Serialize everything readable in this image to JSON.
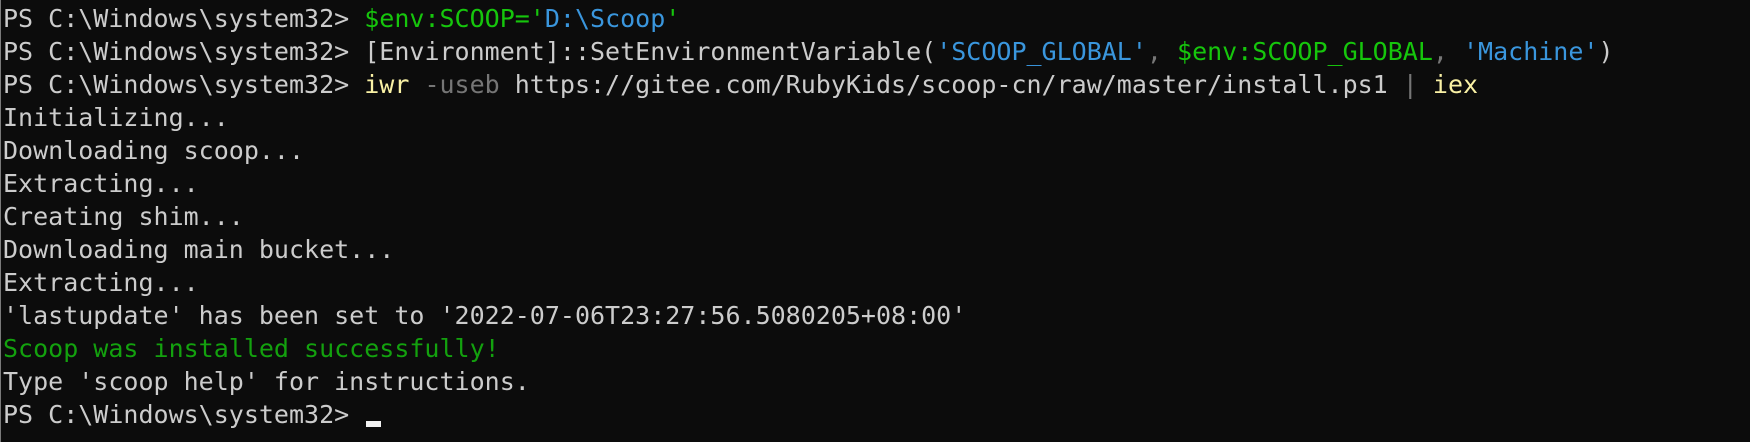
{
  "terminal": {
    "prompt": "PS C:\\Windows\\system32> ",
    "lines": [
      {
        "type": "command",
        "segments": [
          {
            "text": "$env:SCOOP='",
            "role": "var"
          },
          {
            "text": "D:\\Scoop",
            "role": "string"
          },
          {
            "text": "'",
            "role": "var"
          }
        ]
      },
      {
        "type": "command",
        "segments": [
          {
            "text": "[Environment]::SetEnvironmentVariable(",
            "role": "default"
          },
          {
            "text": "'SCOOP_GLOBAL'",
            "role": "string"
          },
          {
            "text": ", ",
            "role": "param"
          },
          {
            "text": "$env:SCOOP_GLOBAL",
            "role": "var"
          },
          {
            "text": ", ",
            "role": "param"
          },
          {
            "text": "'Machine'",
            "role": "string"
          },
          {
            "text": ")",
            "role": "default"
          }
        ]
      },
      {
        "type": "command",
        "segments": [
          {
            "text": "iwr",
            "role": "cmd"
          },
          {
            "text": " -useb",
            "role": "param"
          },
          {
            "text": " https://gitee.com/RubyKids/scoop-cn/raw/master/install.ps1",
            "role": "default"
          },
          {
            "text": " | ",
            "role": "param"
          },
          {
            "text": "iex",
            "role": "cmd"
          }
        ]
      },
      {
        "type": "output",
        "text": "Initializing...",
        "role": "default"
      },
      {
        "type": "output",
        "text": "Downloading scoop...",
        "role": "default"
      },
      {
        "type": "output",
        "text": "Extracting...",
        "role": "default"
      },
      {
        "type": "output",
        "text": "Creating shim...",
        "role": "default"
      },
      {
        "type": "output",
        "text": "Downloading main bucket...",
        "role": "default"
      },
      {
        "type": "output",
        "text": "Extracting...",
        "role": "default"
      },
      {
        "type": "output",
        "text": "'lastupdate' has been set to '2022-07-06T23:27:56.5080205+08:00'",
        "role": "default"
      },
      {
        "type": "output",
        "text": "Scoop was installed successfully!",
        "role": "success"
      },
      {
        "type": "output",
        "text": "Type 'scoop help' for instructions.",
        "role": "default"
      },
      {
        "type": "prompt-cursor"
      }
    ]
  },
  "colors": {
    "background": "#0c0c0c",
    "default": "#cccccc",
    "var": "#16c60c",
    "string": "#3a96dd",
    "param": "#767676",
    "cmd": "#f9f1a5",
    "success": "#13a10e"
  }
}
